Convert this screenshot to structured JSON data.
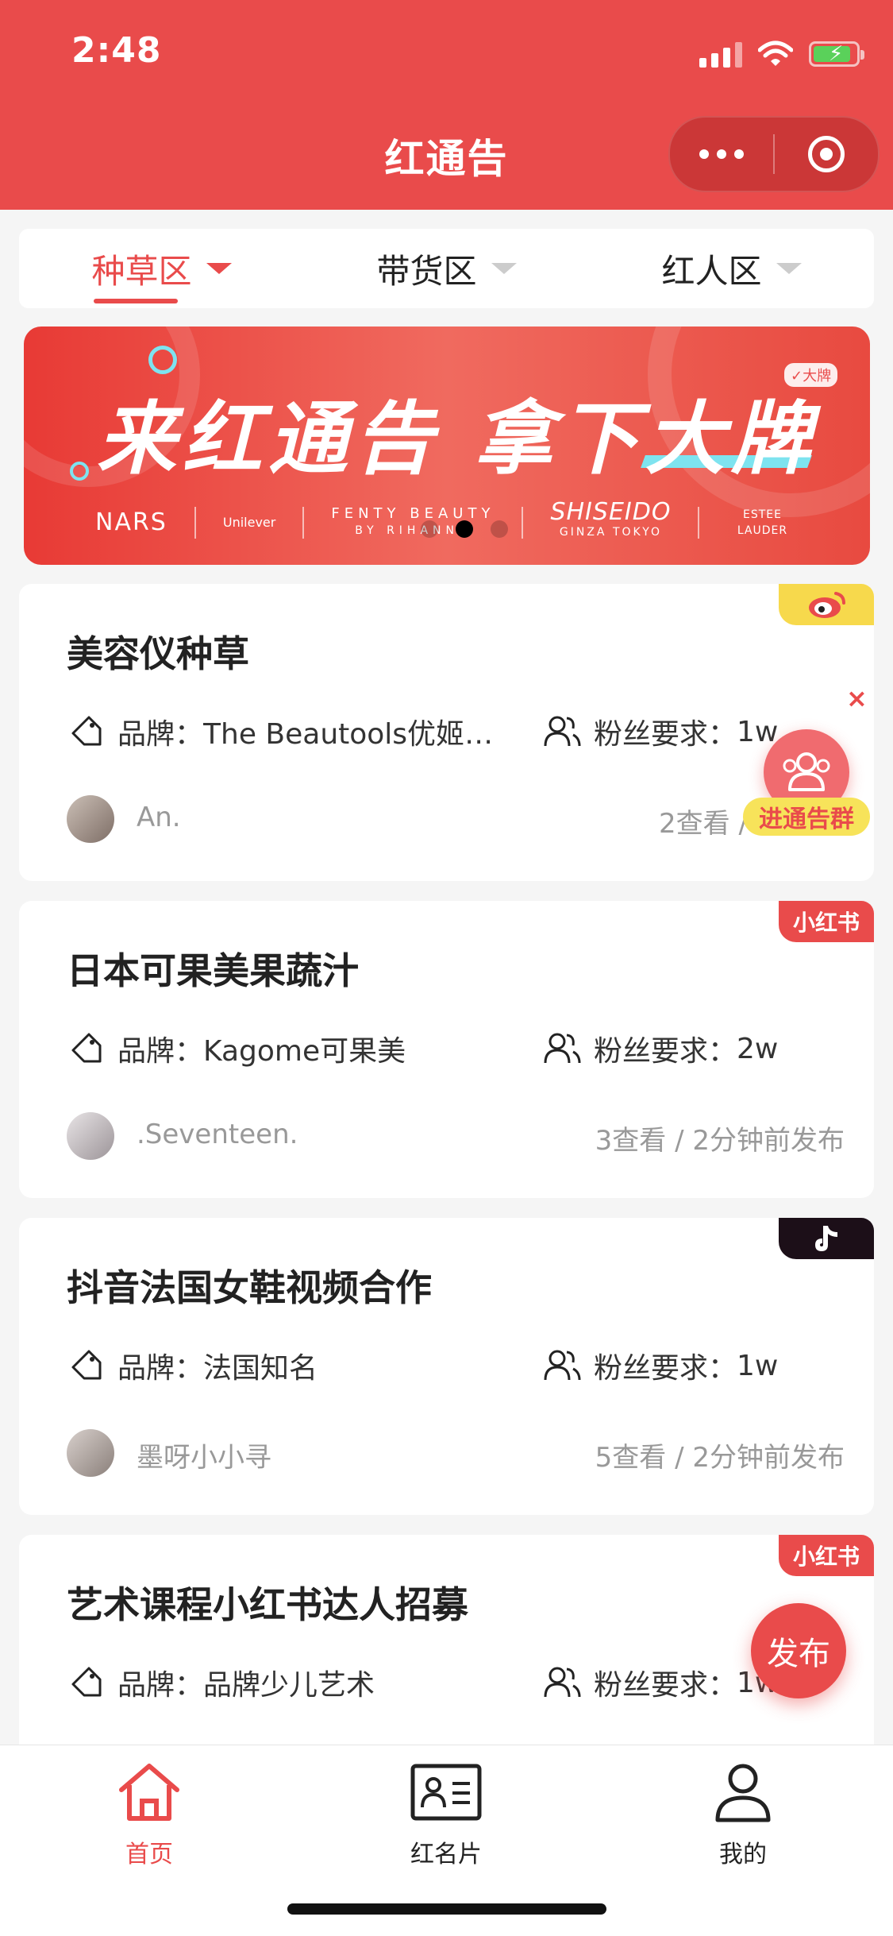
{
  "status_bar": {
    "time": "2:48"
  },
  "nav": {
    "title": "红通告"
  },
  "tabs": [
    {
      "label": "种草区",
      "active": true
    },
    {
      "label": "带货区",
      "active": false
    },
    {
      "label": "红人区",
      "active": false
    }
  ],
  "banner": {
    "headline": "来红通告  拿下大牌",
    "badge": "✓大牌",
    "brands": [
      "NARS",
      "Unilever",
      "FENTY BEAUTY",
      "BY RIHANNA",
      "SHISEIDO",
      "GINZA TOKYO",
      "ESTEE LAUDER"
    ],
    "active_slide": 2,
    "slide_count": 3
  },
  "colors": {
    "accent": "#e94b4b",
    "weibo": "#f7d94c",
    "tiktok": "#1c0f18"
  },
  "posts": [
    {
      "title": "美容仪种草",
      "brand_label": "品牌：",
      "brand": "The Beautools优姬美...",
      "fans_label": "粉丝要求：",
      "fans": "1w",
      "author": "An.",
      "meta": "2查看 / 46秒前",
      "platform": "weibo",
      "platform_icon": "weibo-icon"
    },
    {
      "title": "日本可果美果蔬汁",
      "brand_label": "品牌：",
      "brand": "Kagome可果美",
      "fans_label": "粉丝要求：",
      "fans": "2w",
      "author": ".Seventeen.",
      "meta": "3查看 / 2分钟前发布",
      "platform": "xiaohongshu",
      "platform_label": "小红书"
    },
    {
      "title": "抖音法国女鞋视频合作",
      "brand_label": "品牌：",
      "brand": "法国知名",
      "fans_label": "粉丝要求：",
      "fans": "1w",
      "author": "墨呀小小寻",
      "meta": "5查看 / 2分钟前发布",
      "platform": "tiktok",
      "platform_icon": "tiktok-icon"
    },
    {
      "title": "艺术课程小红书达人招募",
      "brand_label": "品牌：",
      "brand": "品牌少儿艺术",
      "fans_label": "粉丝要求：",
      "fans": "1w",
      "platform": "xiaohongshu",
      "platform_label": "小红书"
    }
  ],
  "float_group": {
    "close": "×",
    "label": "进通告群"
  },
  "fab": {
    "label": "发布"
  },
  "tabbar": [
    {
      "label": "首页",
      "icon": "home-icon",
      "active": true
    },
    {
      "label": "红名片",
      "icon": "id-card-icon",
      "active": false
    },
    {
      "label": "我的",
      "icon": "user-icon",
      "active": false
    }
  ]
}
